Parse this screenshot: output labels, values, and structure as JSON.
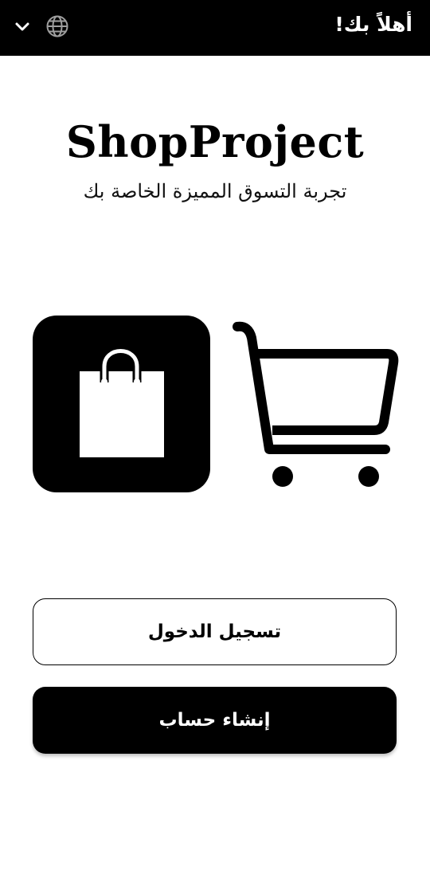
{
  "header": {
    "welcome_text": "أهلاً بك!",
    "language_icon": "globe-icon",
    "dropdown_icon": "chevron-down-icon"
  },
  "brand": {
    "title": "ShopProject",
    "subtitle": "تجربة التسوق المميزة الخاصة بك"
  },
  "illustration": {
    "left_icon": "shopping-bag-icon",
    "right_icon": "shopping-cart-icon"
  },
  "actions": {
    "login_label": "تسجيل الدخول",
    "register_label": "إنشاء حساب"
  },
  "colors": {
    "primary": "#000000",
    "background": "#ffffff",
    "header_icon": "#9e9e9e"
  }
}
